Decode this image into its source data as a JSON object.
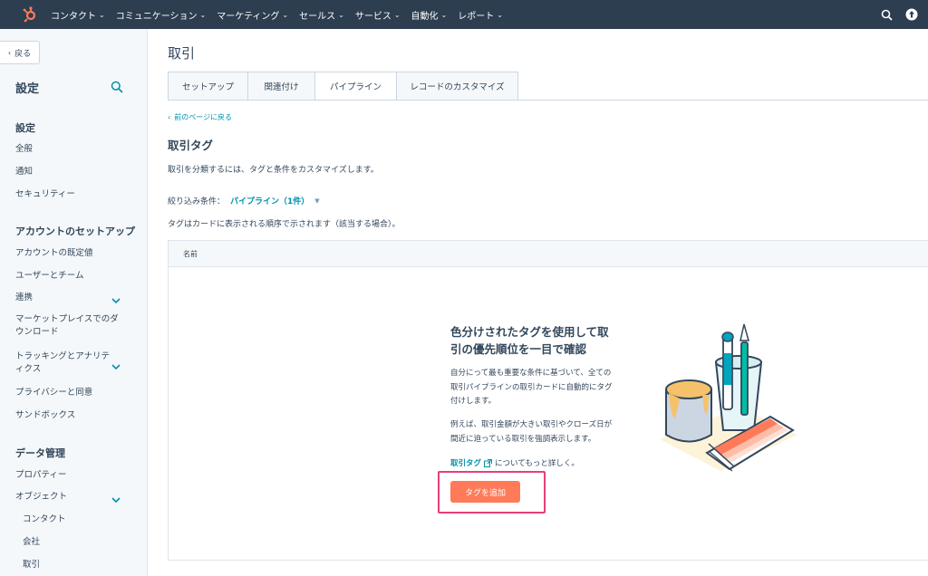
{
  "topnav": {
    "items": [
      "コンタクト",
      "コミュニケーション",
      "マーケティング",
      "セールス",
      "サービス",
      "自動化",
      "レポート"
    ]
  },
  "sidebar": {
    "back_label": "戻る",
    "title": "設定",
    "sections": [
      {
        "heading": "設定",
        "items": [
          "全般",
          "通知",
          "セキュリティー"
        ]
      },
      {
        "heading": "アカウントのセットアップ",
        "items": [
          "アカウントの既定値",
          "ユーザーとチーム",
          "連携",
          "マーケットプレイスでのダウンロード",
          "トラッキングとアナリティクス",
          "プライバシーと同意",
          "サンドボックス"
        ]
      },
      {
        "heading": "データ管理",
        "items": [
          "プロパティー",
          "オブジェクト",
          "コンタクト",
          "会社",
          "取引"
        ]
      }
    ]
  },
  "main": {
    "page_title": "取引",
    "tabs": [
      "セットアップ",
      "関連付け",
      "パイプライン",
      "レコードのカスタマイズ"
    ],
    "active_tab": "パイプライン",
    "prev_link": "前のページに戻る",
    "heading": "取引タグ",
    "description": "取引を分類するには、タグと条件をカスタマイズします。",
    "filter_label": "絞り込み条件：",
    "filter_value": "パイプライン（1件）",
    "note": "タグはカードに表示される順序で示されます（該当する場合）。",
    "table_header": "名前",
    "empty": {
      "title_line1": "色分けされたタグを使用して取",
      "title_line2": "引の優先順位を一目で確認",
      "p1_line1": "自分にって最も重要な条件に基づいて、全ての",
      "p1_line2": "取引パイプラインの取引カードに自動的にタグ",
      "p1_line3": "付けします。",
      "p2_line1": "例えば、取引金額が大きい取引やクローズ日が",
      "p2_line2": "間近に迫っている取引を強調表示します。",
      "link_text": "取引タグ",
      "link_suffix": "についてもっと詳しく。",
      "button_label": "タグを追加"
    }
  },
  "colors": {
    "nav_bg": "#2d3e50",
    "accent": "#0091ae",
    "button": "#ff7a59",
    "highlight": "#e5407b"
  }
}
